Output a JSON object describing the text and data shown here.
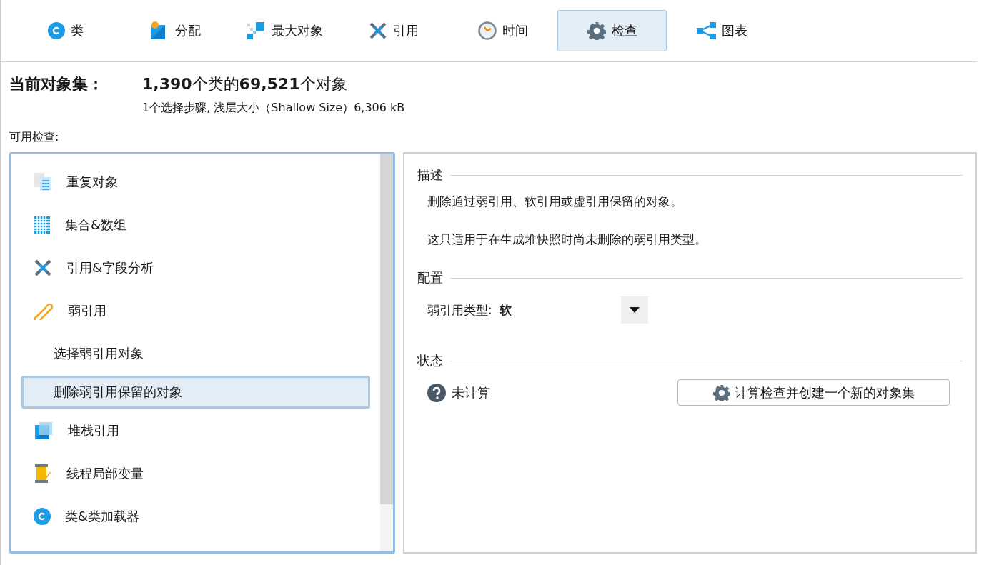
{
  "tabs": [
    {
      "label": "类",
      "selected": false
    },
    {
      "label": "分配",
      "selected": false
    },
    {
      "label": "最大对象",
      "selected": false
    },
    {
      "label": "引用",
      "selected": false
    },
    {
      "label": "时间",
      "selected": false
    },
    {
      "label": "检查",
      "selected": true
    },
    {
      "label": "图表",
      "selected": false
    }
  ],
  "object_set": {
    "label": "当前对象集：",
    "summary": "**1,390**个类的**69,521**个对象",
    "detail": "1个选择步骤, 浅层大小（Shallow Size）6,306 kB"
  },
  "checks": {
    "label": "可用检查:",
    "items": [
      {
        "kind": "item",
        "label": "重复对象",
        "selected": false
      },
      {
        "kind": "item",
        "label": "集合&数组",
        "selected": false
      },
      {
        "kind": "item",
        "label": "引用&字段分析",
        "selected": false
      },
      {
        "kind": "item",
        "label": "弱引用",
        "selected": false
      },
      {
        "kind": "sub",
        "label": "选择弱引用对象",
        "selected": false
      },
      {
        "kind": "sub",
        "label": "删除弱引用保留的对象",
        "selected": true
      },
      {
        "kind": "item",
        "label": "堆栈引用",
        "selected": false
      },
      {
        "kind": "item",
        "label": "线程局部变量",
        "selected": false
      },
      {
        "kind": "item",
        "label": "类&类加载器",
        "selected": false
      }
    ]
  },
  "details": {
    "description": {
      "title": "描述",
      "paragraphs": [
        "删除通过弱引用、软引用或虚引用保留的对象。",
        "这只适用于在生成堆快照时尚未删除的弱引用类型。"
      ]
    },
    "configuration": {
      "title": "配置",
      "field_label": "弱引用类型:",
      "field_value": "软"
    },
    "status": {
      "title": "状态",
      "state": "未计算",
      "button": "计算检查并创建一个新的对象集"
    }
  }
}
